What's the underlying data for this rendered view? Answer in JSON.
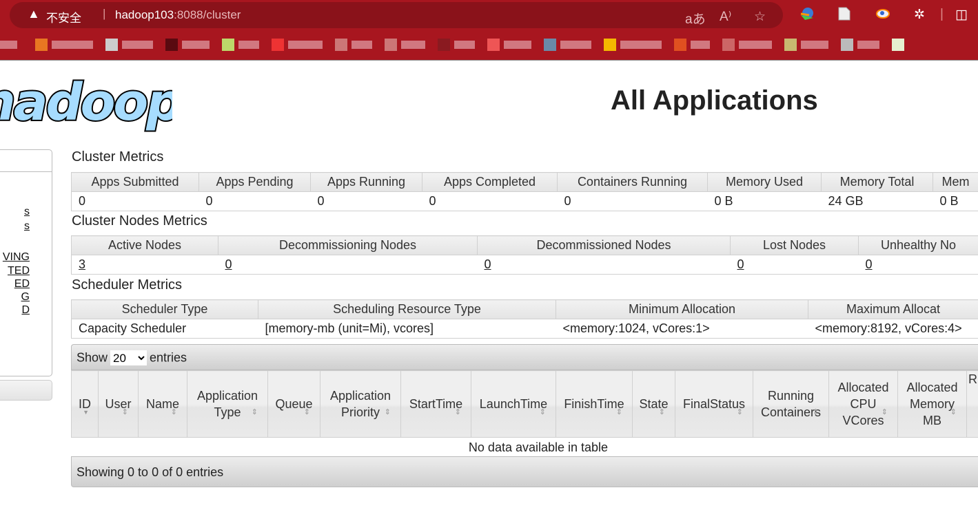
{
  "browser": {
    "insecure_label": "不安全",
    "url_host": "hadoop103",
    "url_rest": ":8088/cluster",
    "icons": [
      "warning-icon",
      "read-aloud-translate-icon",
      "read-aloud-icon",
      "favorite-star-icon",
      "download-manager-icon",
      "document-icon",
      "browser-extension-icon",
      "extensions-icon",
      "split-screen-icon"
    ]
  },
  "page": {
    "title": "All Applications",
    "logo_text": "hadoop"
  },
  "sidebar": {
    "fragments": [
      "s",
      "s",
      "VING",
      "TED",
      "ED",
      "G",
      "D"
    ]
  },
  "cluster_metrics": {
    "title": "Cluster Metrics",
    "headers": [
      "Apps Submitted",
      "Apps Pending",
      "Apps Running",
      "Apps Completed",
      "Containers Running",
      "Memory Used",
      "Memory Total",
      "Mem"
    ],
    "values": [
      "0",
      "0",
      "0",
      "0",
      "0",
      "0 B",
      "24 GB",
      "0 B"
    ]
  },
  "nodes_metrics": {
    "title": "Cluster Nodes Metrics",
    "headers": [
      "Active Nodes",
      "Decommissioning Nodes",
      "Decommissioned Nodes",
      "Lost Nodes",
      "Unhealthy No"
    ],
    "values": [
      "3",
      "0",
      "0",
      "0",
      "0"
    ]
  },
  "scheduler_metrics": {
    "title": "Scheduler Metrics",
    "headers": [
      "Scheduler Type",
      "Scheduling Resource Type",
      "Minimum Allocation",
      "Maximum Allocat"
    ],
    "values": [
      "Capacity Scheduler",
      "[memory-mb (unit=Mi), vcores]",
      "<memory:1024, vCores:1>",
      "<memory:8192, vCores:4>"
    ]
  },
  "apps": {
    "show_label": "Show",
    "entries_label": "entries",
    "page_size": "20",
    "headers": [
      "ID",
      "User",
      "Name",
      "Application Type",
      "Queue",
      "Application Priority",
      "StartTime",
      "LaunchTime",
      "FinishTime",
      "State",
      "FinalStatus",
      "Running Containers",
      "Allocated CPU VCores",
      "Allocated Memory MB",
      "R"
    ],
    "empty": "No data available in table",
    "info": "Showing 0 to 0 of 0 entries"
  }
}
